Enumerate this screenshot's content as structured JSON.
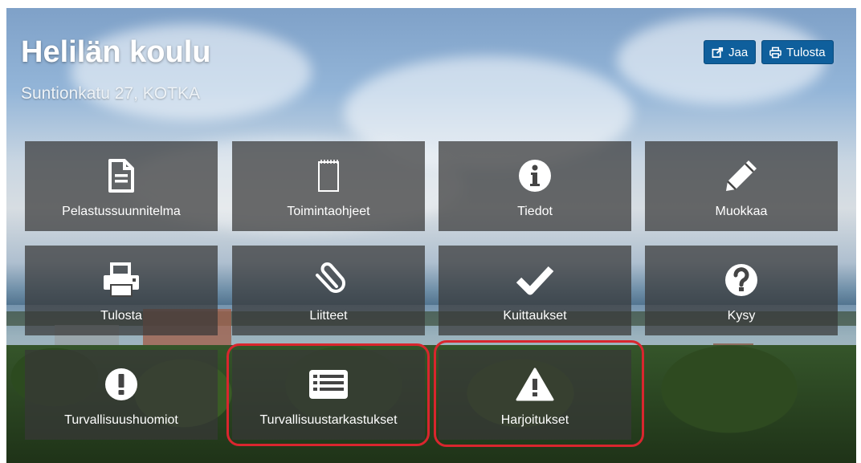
{
  "header": {
    "title": "Helilän koulu",
    "address": "Suntionkatu 27, KOTKA"
  },
  "toolbar": {
    "share_label": "Jaa",
    "share_icon": "share-icon",
    "print_label": "Tulosta",
    "print_icon": "print-icon",
    "button_color": "#0f5f9c"
  },
  "tiles": [
    {
      "label": "Pelastussuunnitelma",
      "icon": "document-icon"
    },
    {
      "label": "Toimintaohjeet",
      "icon": "notepad-icon"
    },
    {
      "label": "Tiedot",
      "icon": "info-icon"
    },
    {
      "label": "Muokkaa",
      "icon": "pencil-icon"
    },
    {
      "label": "Tulosta",
      "icon": "printer-icon"
    },
    {
      "label": "Liitteet",
      "icon": "paperclip-icon"
    },
    {
      "label": "Kuittaukset",
      "icon": "checkmark-icon"
    },
    {
      "label": "Kysy",
      "icon": "question-icon"
    },
    {
      "label": "Turvallisuushuomiot",
      "icon": "exclamation-icon"
    },
    {
      "label": "Turvallisuustarkastukset",
      "icon": "list-icon"
    },
    {
      "label": "Harjoitukset",
      "icon": "warning-icon"
    }
  ],
  "highlight_color": "#d9262e"
}
